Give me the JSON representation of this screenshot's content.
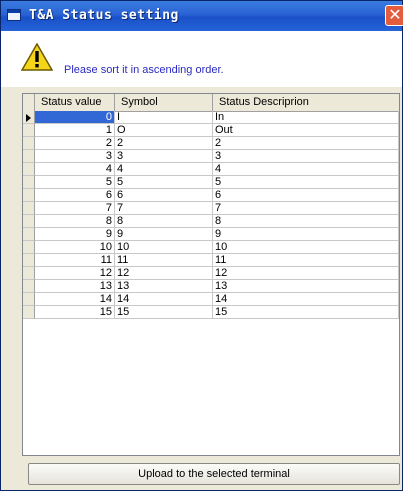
{
  "window": {
    "title": "T&A Status setting"
  },
  "info": {
    "message": "Please sort it in ascending order."
  },
  "table": {
    "columns": [
      "Status value",
      "Symbol",
      "Status Descriprion"
    ],
    "rows": [
      [
        "0",
        "I",
        "In"
      ],
      [
        "1",
        "O",
        "Out"
      ],
      [
        "2",
        "2",
        "2"
      ],
      [
        "3",
        "3",
        "3"
      ],
      [
        "4",
        "4",
        "4"
      ],
      [
        "5",
        "5",
        "5"
      ],
      [
        "6",
        "6",
        "6"
      ],
      [
        "7",
        "7",
        "7"
      ],
      [
        "8",
        "8",
        "8"
      ],
      [
        "9",
        "9",
        "9"
      ],
      [
        "10",
        "10",
        "10"
      ],
      [
        "11",
        "11",
        "11"
      ],
      [
        "12",
        "12",
        "12"
      ],
      [
        "13",
        "13",
        "13"
      ],
      [
        "14",
        "14",
        "14"
      ],
      [
        "15",
        "15",
        "15"
      ]
    ]
  },
  "buttons": {
    "upload_label": "Upload to the selected terminal"
  },
  "colors": {
    "accent": "#3168d5",
    "info_text": "#2a2ac0"
  }
}
